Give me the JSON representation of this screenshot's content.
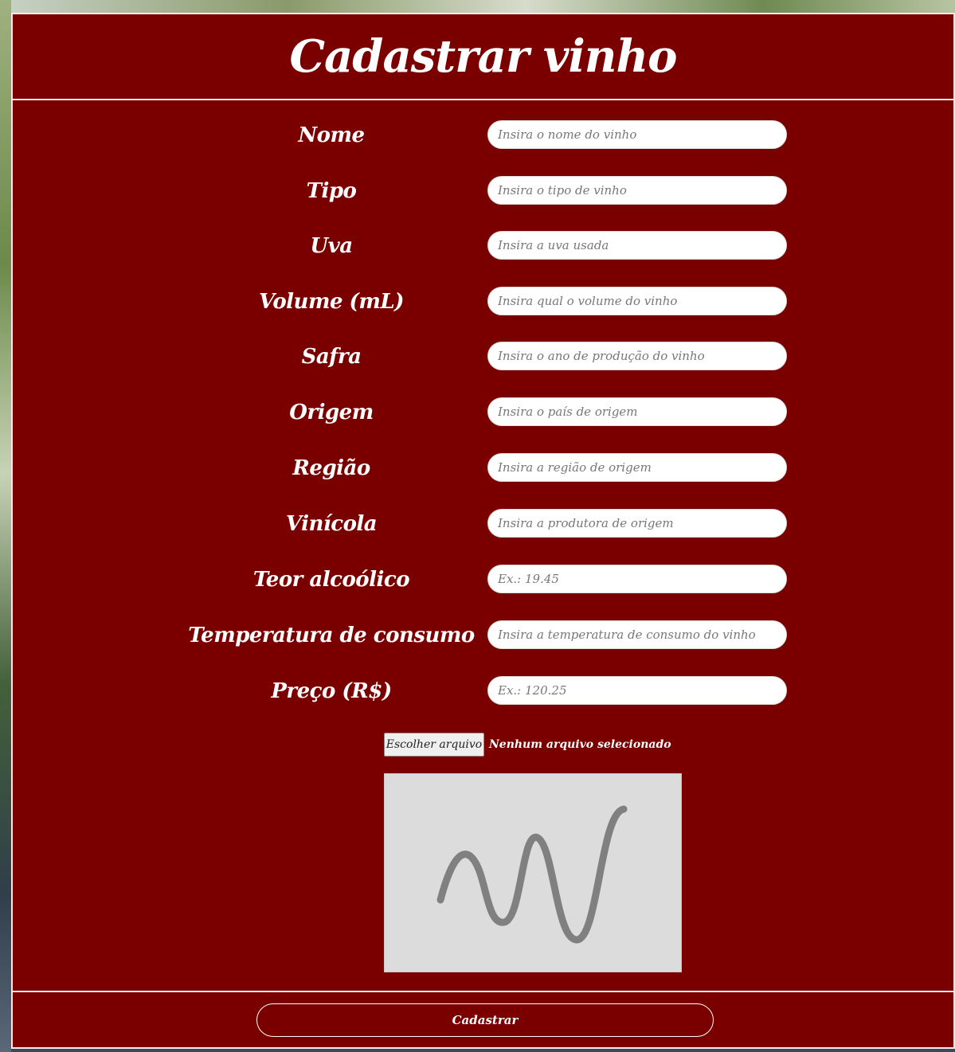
{
  "page": {
    "title": "Cadastrar vinho"
  },
  "form": {
    "fields": [
      {
        "label": "Nome",
        "placeholder": "Insira o nome do vinho",
        "value": ""
      },
      {
        "label": "Tipo",
        "placeholder": "Insira o tipo de vinho",
        "value": ""
      },
      {
        "label": "Uva",
        "placeholder": "Insira a uva usada",
        "value": ""
      },
      {
        "label": "Volume (mL)",
        "placeholder": "Insira qual o volume do vinho",
        "value": ""
      },
      {
        "label": "Safra",
        "placeholder": "Insira o ano de produção do vinho",
        "value": ""
      },
      {
        "label": "Origem",
        "placeholder": "Insira o país de origem",
        "value": ""
      },
      {
        "label": "Região",
        "placeholder": "Insira a região de origem",
        "value": ""
      },
      {
        "label": "Vinícola",
        "placeholder": "Insira a produtora de origem",
        "value": ""
      },
      {
        "label": "Teor alcoólico",
        "placeholder": "Ex.: 19.45",
        "value": ""
      },
      {
        "label": "Temperatura de consumo",
        "placeholder": "Insira a temperatura de consumo do vinho",
        "value": ""
      },
      {
        "label": "Preço (R$)",
        "placeholder": "Ex.: 120.25",
        "value": ""
      }
    ],
    "file": {
      "button_label": "Escolher arquivo",
      "status": "Nenhum arquivo selecionado"
    },
    "preview": {
      "icon": "image-placeholder-icon"
    },
    "submit_label": "Cadastrar"
  },
  "colors": {
    "panel_background": "#7a0000",
    "panel_border": "#f3e9e9",
    "text": "#ffffff",
    "input_background": "#ffffff",
    "preview_background": "#dcdcdc",
    "preview_stroke": "#808080"
  }
}
